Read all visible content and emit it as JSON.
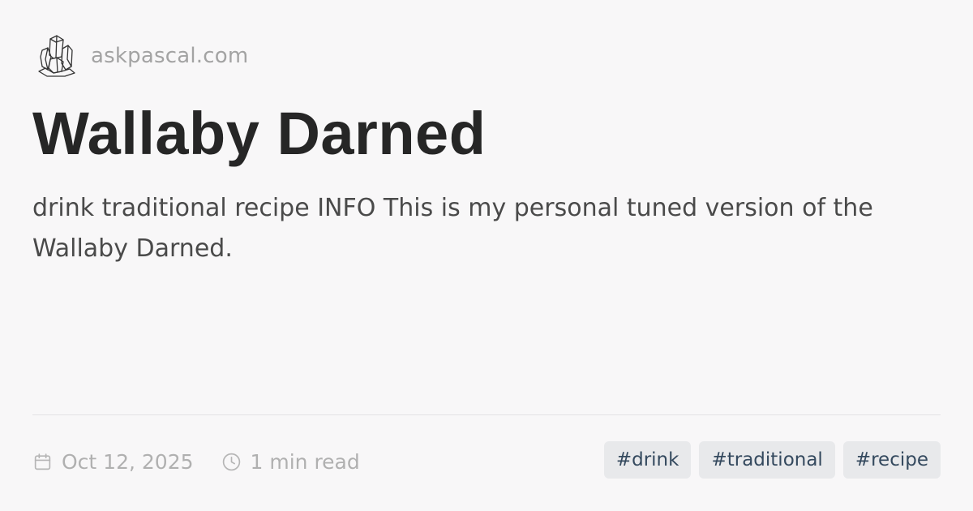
{
  "site": {
    "logo_icon": "crystal-icon",
    "name": "askpascal.com"
  },
  "post": {
    "title": "Wallaby Darned",
    "description": "drink traditional recipe INFO This is my personal tuned version of the Wallaby Darned."
  },
  "meta": {
    "date_icon": "calendar-icon",
    "date": "Oct 12, 2025",
    "read_icon": "clock-icon",
    "read_time": "1 min read"
  },
  "tags": [
    "#drink",
    "#traditional",
    "#recipe"
  ],
  "colors": {
    "background": "#f8f7f8",
    "title": "#262626",
    "muted": "#a3a3a3",
    "tag_background": "#e8e9eb",
    "tag_text": "#34495e"
  }
}
